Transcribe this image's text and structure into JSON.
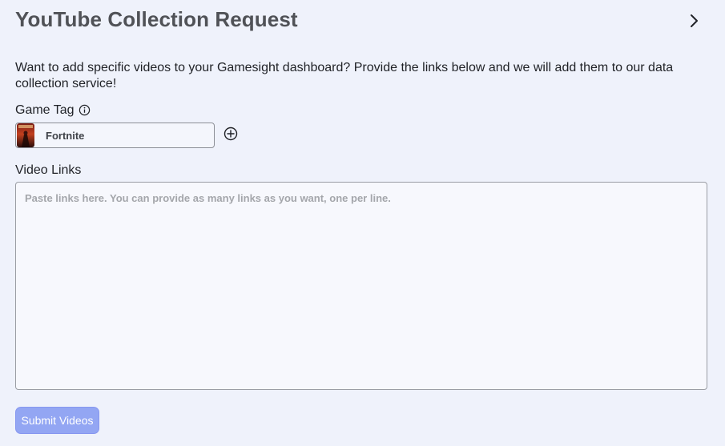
{
  "header": {
    "title": "YouTube Collection Request",
    "next_icon": "chevron-right-icon"
  },
  "description": "Want to add specific videos to your Gamesight dashboard? Provide the links below and we will add them to our data collection service!",
  "game_tag": {
    "label": "Game Tag",
    "info_icon": "info-icon",
    "selected_value": "Fortnite",
    "add_icon": "plus-circle-icon"
  },
  "video_links": {
    "label": "Video Links",
    "value": "",
    "placeholder": "Paste links here. You can provide as many links as you want, one per line."
  },
  "submit": {
    "label": "Submit Videos"
  },
  "colors": {
    "background": "#eff2fb",
    "title": "#505257",
    "submit_button": "#93a6f3",
    "submit_text": "#ffffff"
  }
}
